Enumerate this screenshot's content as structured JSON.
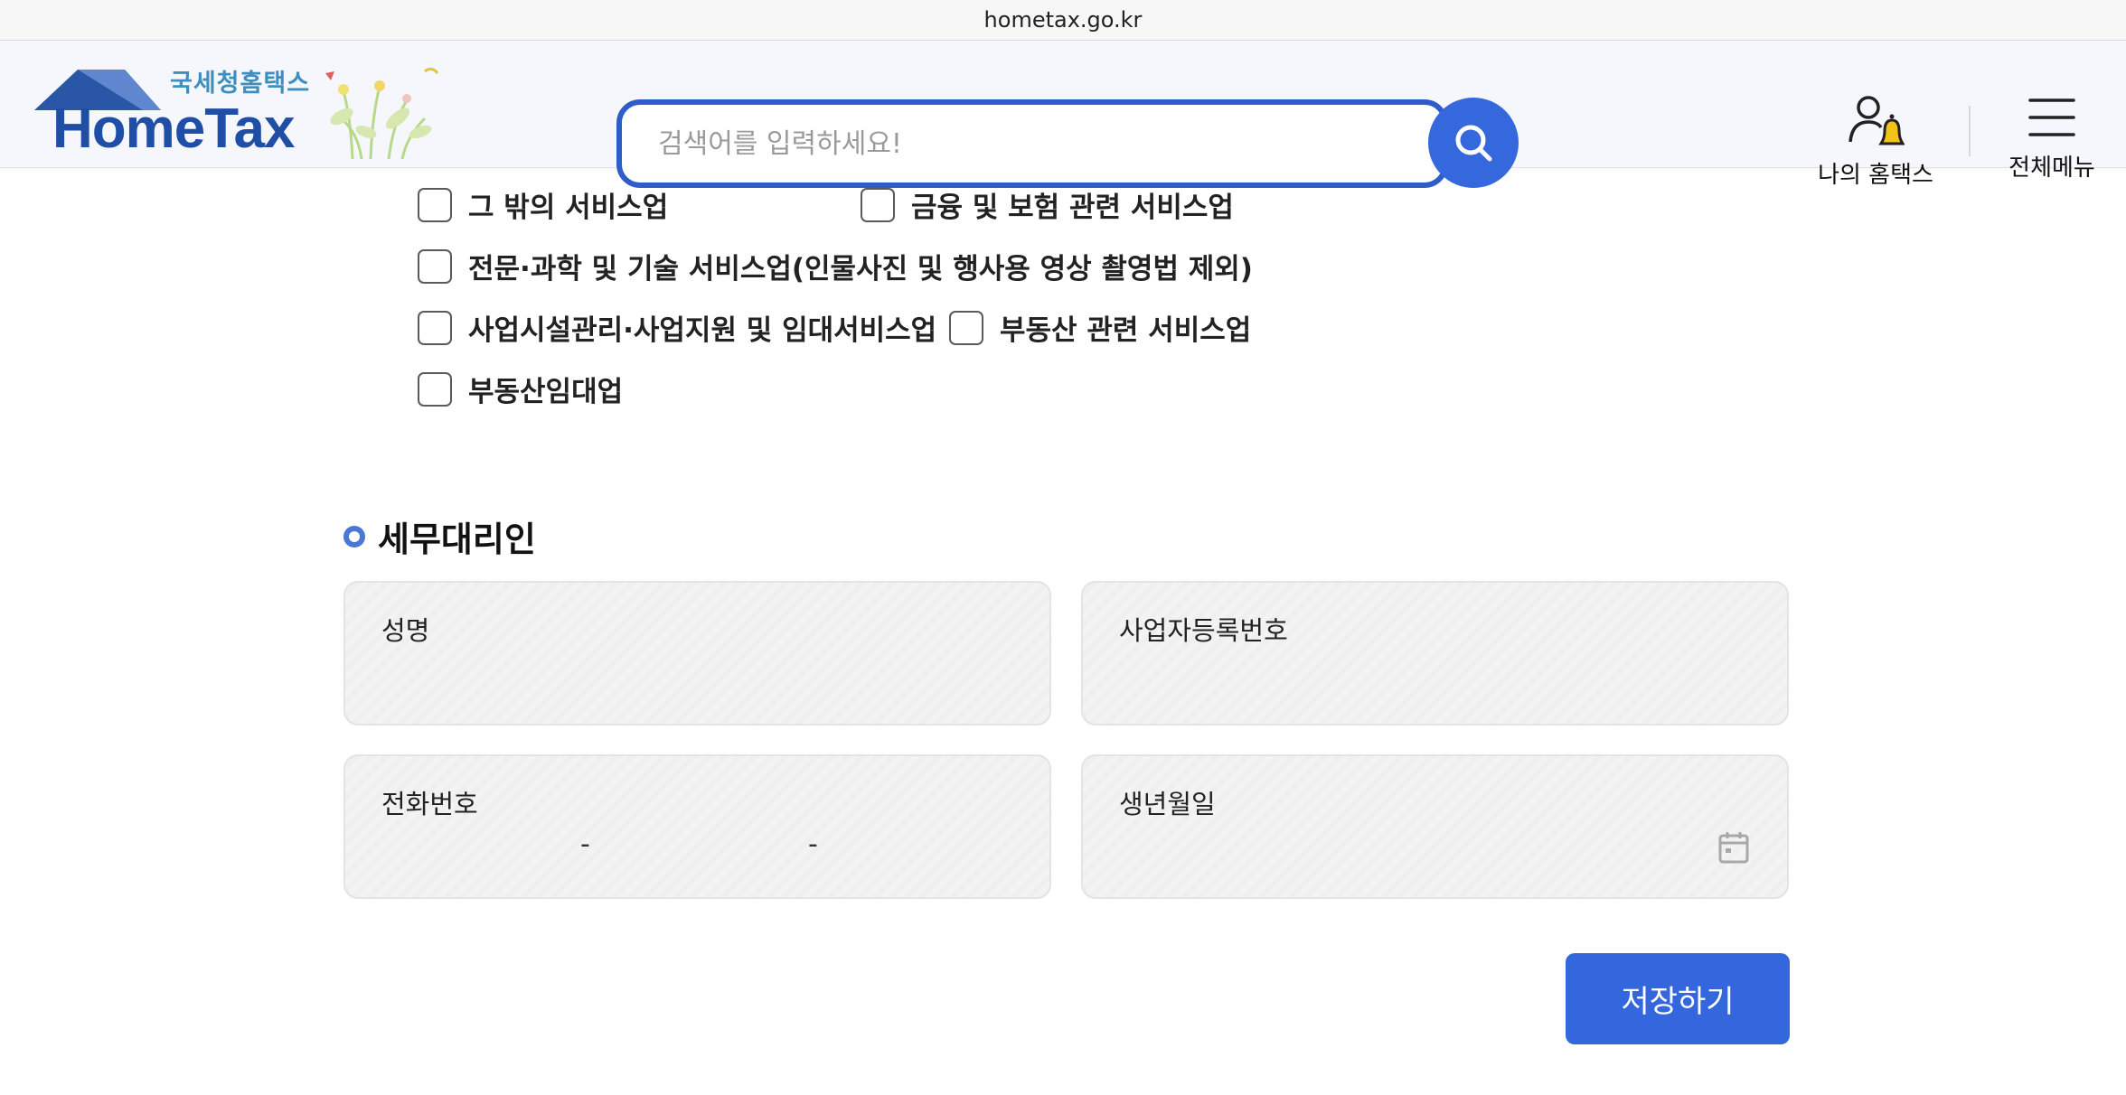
{
  "browser": {
    "url": "hometax.go.kr"
  },
  "header": {
    "logo_sub": "국세청홈택스",
    "logo_main": "HomeTax",
    "search_placeholder": "검색어를 입력하세요!",
    "my_hometax": "나의 홈택스",
    "all_menu": "전체메뉴",
    "brand_color": "#2f5cc8"
  },
  "business_types": {
    "items": [
      {
        "label": "그 밖의 서비스업",
        "checked": false
      },
      {
        "label": "금융 및 보험 관련 서비스업",
        "checked": false
      },
      {
        "label": "전문·과학 및 기술 서비스업(인물사진 및 행사용 영상 촬영법 제외)",
        "checked": false
      },
      {
        "label": "사업시설관리·사업지원 및 임대서비스업",
        "checked": false
      },
      {
        "label": "부동산 관련 서비스업",
        "checked": false
      },
      {
        "label": "부동산임대업",
        "checked": false
      }
    ]
  },
  "tax_agent": {
    "section_title": "세무대리인",
    "name_label": "성명",
    "biz_reg_label": "사업자등록번호",
    "phone_label": "전화번호",
    "phone_separator": "-",
    "birth_label": "생년월일"
  },
  "actions": {
    "save_label": "저장하기"
  }
}
